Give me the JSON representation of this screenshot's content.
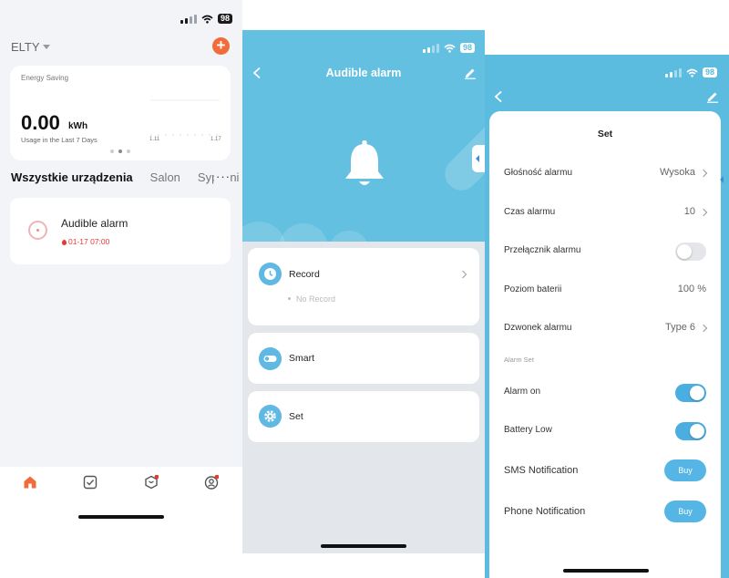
{
  "screen1": {
    "battery": "98",
    "home_name": "ELTY",
    "add_symbol": "+",
    "energy": {
      "label": "Energy Saving",
      "value": "0.00",
      "unit": "kWh",
      "subtitle": "Usage in the Last 7 Days",
      "axis_start": "1.11",
      "axis_end": "1.17"
    },
    "rooms": [
      "Wszystkie urządzenia",
      "Salon",
      "Sypialnia"
    ],
    "more": "···",
    "device": {
      "name": "Audible alarm",
      "status": "01-17 07:00"
    },
    "tabs": [
      "home-icon",
      "scene-icon",
      "explore-icon",
      "profile-icon"
    ],
    "accent_color": "#f26b3a"
  },
  "screen2": {
    "battery": "98",
    "title": "Audible alarm",
    "hero_color": "#63c0e0",
    "items": [
      {
        "label": "Record",
        "sub": "No Record"
      },
      {
        "label": "Smart"
      },
      {
        "label": "Set"
      }
    ]
  },
  "screen3": {
    "battery": "98",
    "sheet_title": "Set",
    "rows": {
      "volume": {
        "label": "Głośność alarmu",
        "value": "Wysoka"
      },
      "duration": {
        "label": "Czas alarmu",
        "value": "10"
      },
      "switch": {
        "label": "Przełącznik alarmu",
        "on": false
      },
      "battery": {
        "label": "Poziom baterii",
        "value": "100 %"
      },
      "ringtone": {
        "label": "Dzwonek alarmu",
        "value": "Type 6"
      }
    },
    "section_label": "Alarm Set",
    "alarm_on": {
      "label": "Alarm on",
      "on": true
    },
    "battery_low": {
      "label": "Battery Low",
      "on": true
    },
    "sms": {
      "label": "SMS Notification",
      "button": "Buy"
    },
    "phone": {
      "label": "Phone Notification",
      "button": "Buy"
    },
    "accent_color": "#4aaee0"
  }
}
